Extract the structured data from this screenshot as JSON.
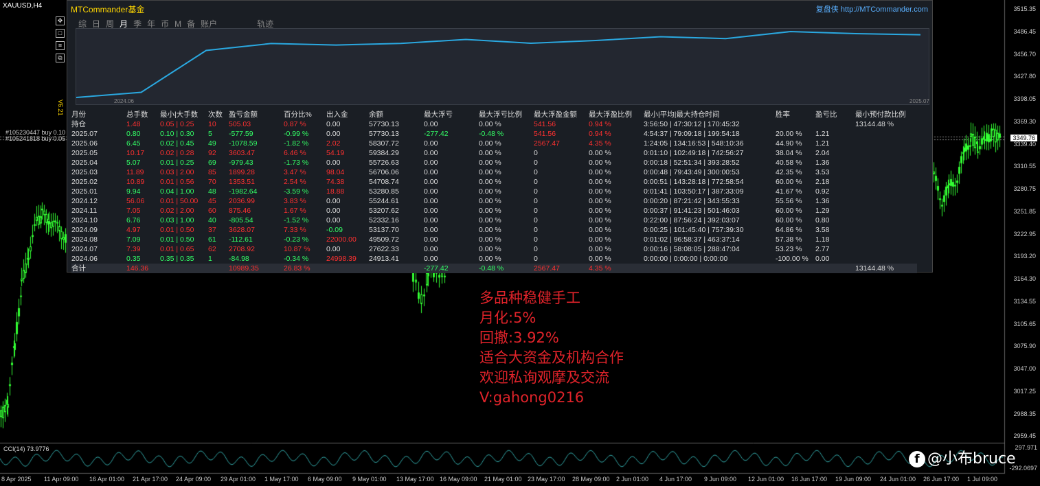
{
  "symbol": "XAUUSD,H4",
  "version": "V6.21",
  "orders": [
    "#105230447 buy 0.10",
    "#105241818 buy 0.05"
  ],
  "price_axis": [
    "3515.35",
    "3486.45",
    "3456.70",
    "3427.80",
    "3398.05",
    "3369.30",
    "3339.40",
    "3310.55",
    "3280.75",
    "3251.85",
    "3222.95",
    "3193.20",
    "3164.30",
    "3134.55",
    "3105.65",
    "3075.90",
    "3047.00",
    "3017.25",
    "2988.35",
    "2959.45"
  ],
  "current_price": "3349.76",
  "cci": {
    "label": "CCI(14) 73.9776",
    "top": "297.971",
    "bottom": "-292.0697"
  },
  "date_axis": [
    "8 Apr 2025",
    "11 Apr 09:00",
    "16 Apr 01:00",
    "21 Apr 17:00",
    "24 Apr 09:00",
    "29 Apr 01:00",
    "1 May 17:00",
    "6 May 09:00",
    "9 May 01:00",
    "13 May 17:00",
    "16 May 09:00",
    "21 May 01:00",
    "23 May 17:00",
    "28 May 09:00",
    "2 Jun 01:00",
    "4 Jun 17:00",
    "9 Jun 09:00",
    "12 Jun 01:00",
    "16 Jun 17:00",
    "19 Jun 09:00",
    "24 Jun 01:00",
    "26 Jun 17:00",
    "1 Jul 09:00"
  ],
  "panel": {
    "title": "MTCommander基金",
    "link": "复盘侠 http://MTCommander.com",
    "tabs": [
      "综",
      "日",
      "周",
      "月",
      "季",
      "年",
      "币",
      "M",
      "备",
      "账户",
      "轨迹"
    ],
    "active_tab": "月",
    "mini_chart": {
      "start_label": "2024.06",
      "end_label": "2025.07",
      "values": [
        24913.41,
        27622.33,
        49509.72,
        53137.7,
        52332.16,
        53207.62,
        55244.61,
        53280.85,
        54708.74,
        56706.06,
        55726.63,
        59384.29,
        58307.72,
        57730.13
      ]
    },
    "headers": [
      "月份",
      "总手数",
      "最小|大手数",
      "次数",
      "盈亏金额",
      "百分比%",
      "出入金",
      "余额",
      "最大浮亏",
      "最大浮亏比例",
      "最大浮盈金额",
      "最大浮盈比例",
      "最小|平均|最大持仓时间",
      "胜率",
      "盈亏比",
      "最小预付款比例"
    ],
    "rows": [
      [
        "持仓",
        "1.48",
        "0.05 | 0.25",
        "10",
        "505.03",
        "0.87 %",
        "0.00",
        "57730.13",
        "0.00",
        "0.00 %",
        "541.56",
        "0.94 %",
        "3:56:50 | 47:30:12 | 170:45:32",
        "",
        "",
        "13144.48 %"
      ],
      [
        "2025.07",
        "0.80",
        "0.10 | 0.30",
        "5",
        "-577.59",
        "-0.99 %",
        "0.00",
        "57730.13",
        "-277.42",
        "-0.48 %",
        "541.56",
        "0.94 %",
        "4:54:37 | 79:09:18 | 199:54:18",
        "20.00 %",
        "1.21",
        ""
      ],
      [
        "2025.06",
        "6.45",
        "0.02 | 0.45",
        "49",
        "-1078.59",
        "-1.82 %",
        "2.02",
        "58307.72",
        "0.00",
        "0.00 %",
        "2567.47",
        "4.35 %",
        "1:24:05 | 134:16:53 | 548:10:36",
        "44.90 %",
        "1.21",
        ""
      ],
      [
        "2025.05",
        "10.17",
        "0.02 | 0.28",
        "92",
        "3603.47",
        "6.46 %",
        "54.19",
        "59384.29",
        "0.00",
        "0.00 %",
        "0",
        "0.00 %",
        "0:01:10 | 102:49:18 | 742:56:27",
        "38.04 %",
        "2.04",
        ""
      ],
      [
        "2025.04",
        "5.07",
        "0.01 | 0.25",
        "69",
        "-979.43",
        "-1.73 %",
        "0.00",
        "55726.63",
        "0.00",
        "0.00 %",
        "0",
        "0.00 %",
        "0:00:18 | 52:51:34 | 393:28:52",
        "40.58 %",
        "1.36",
        ""
      ],
      [
        "2025.03",
        "11.89",
        "0.03 | 2.00",
        "85",
        "1899.28",
        "3.47 %",
        "98.04",
        "56706.06",
        "0.00",
        "0.00 %",
        "0",
        "0.00 %",
        "0:00:48 | 79:43:49 | 300:00:53",
        "42.35 %",
        "3.53",
        ""
      ],
      [
        "2025.02",
        "10.89",
        "0.01 | 0.56",
        "70",
        "1353.51",
        "2.54 %",
        "74.38",
        "54708.74",
        "0.00",
        "0.00 %",
        "0",
        "0.00 %",
        "0:00:51 | 143:28:18 | 772:58:54",
        "60.00 %",
        "2.18",
        ""
      ],
      [
        "2025.01",
        "9.94",
        "0.04 | 1.00",
        "48",
        "-1982.64",
        "-3.59 %",
        "18.88",
        "53280.85",
        "0.00",
        "0.00 %",
        "0",
        "0.00 %",
        "0:01:41 | 103:50:17 | 387:33:09",
        "41.67 %",
        "0.92",
        ""
      ],
      [
        "2024.12",
        "56.06",
        "0.01 | 50.00",
        "45",
        "2036.99",
        "3.83 %",
        "0.00",
        "55244.61",
        "0.00",
        "0.00 %",
        "0",
        "0.00 %",
        "0:00:20 | 87:21:42 | 343:55:33",
        "55.56 %",
        "1.36",
        ""
      ],
      [
        "2024.11",
        "7.05",
        "0.02 | 2.00",
        "60",
        "875.46",
        "1.67 %",
        "0.00",
        "53207.62",
        "0.00",
        "0.00 %",
        "0",
        "0.00 %",
        "0:00:37 | 91:41:23 | 501:46:03",
        "60.00 %",
        "1.29",
        ""
      ],
      [
        "2024.10",
        "6.76",
        "0.03 | 1.00",
        "40",
        "-805.54",
        "-1.52 %",
        "0.00",
        "52332.16",
        "0.00",
        "0.00 %",
        "0",
        "0.00 %",
        "0:22:00 | 87:56:24 | 392:03:07",
        "60.00 %",
        "0.80",
        ""
      ],
      [
        "2024.09",
        "4.97",
        "0.01 | 0.50",
        "37",
        "3628.07",
        "7.33 %",
        "-0.09",
        "53137.70",
        "0.00",
        "0.00 %",
        "0",
        "0.00 %",
        "0:00:25 | 101:45:40 | 757:39:30",
        "64.86 %",
        "3.58",
        ""
      ],
      [
        "2024.08",
        "7.09",
        "0.01 | 0.50",
        "61",
        "-112.61",
        "-0.23 %",
        "22000.00",
        "49509.72",
        "0.00",
        "0.00 %",
        "0",
        "0.00 %",
        "0:01:02 | 96:58:37 | 463:37:14",
        "57.38 %",
        "1.18",
        ""
      ],
      [
        "2024.07",
        "7.39",
        "0.01 | 0.65",
        "62",
        "2708.92",
        "10.87 %",
        "0.00",
        "27622.33",
        "0.00",
        "0.00 %",
        "0",
        "0.00 %",
        "0:00:16 | 58:08:05 | 288:47:04",
        "53.23 %",
        "2.77",
        ""
      ],
      [
        "2024.06",
        "0.35",
        "0.35 | 0.35",
        "1",
        "-84.98",
        "-0.34 %",
        "24998.39",
        "24913.41",
        "0.00",
        "0.00 %",
        "0",
        "0.00 %",
        "0:00:00 | 0:00:00 | 0:00:00",
        "-100.00 %",
        "0.00",
        ""
      ]
    ],
    "row_colors": [
      [
        "w",
        "r",
        "r",
        "r",
        "r",
        "r",
        "w",
        "w",
        "w",
        "w",
        "r",
        "r",
        "w",
        "w",
        "w",
        "w"
      ],
      [
        "w",
        "g",
        "g",
        "g",
        "g",
        "g",
        "w",
        "w",
        "g",
        "g",
        "r",
        "r",
        "w",
        "w",
        "w",
        "w"
      ],
      [
        "w",
        "g",
        "g",
        "g",
        "g",
        "g",
        "r",
        "w",
        "w",
        "w",
        "r",
        "r",
        "w",
        "w",
        "w",
        "w"
      ],
      [
        "w",
        "r",
        "r",
        "r",
        "r",
        "r",
        "r",
        "w",
        "w",
        "w",
        "w",
        "w",
        "w",
        "w",
        "w",
        "w"
      ],
      [
        "w",
        "g",
        "g",
        "g",
        "g",
        "g",
        "w",
        "w",
        "w",
        "w",
        "w",
        "w",
        "w",
        "w",
        "w",
        "w"
      ],
      [
        "w",
        "r",
        "r",
        "r",
        "r",
        "r",
        "r",
        "w",
        "w",
        "w",
        "w",
        "w",
        "w",
        "w",
        "w",
        "w"
      ],
      [
        "w",
        "r",
        "r",
        "r",
        "r",
        "r",
        "r",
        "w",
        "w",
        "w",
        "w",
        "w",
        "w",
        "w",
        "w",
        "w"
      ],
      [
        "w",
        "g",
        "g",
        "g",
        "g",
        "g",
        "r",
        "w",
        "w",
        "w",
        "w",
        "w",
        "w",
        "w",
        "w",
        "w"
      ],
      [
        "w",
        "r",
        "r",
        "r",
        "r",
        "r",
        "w",
        "w",
        "w",
        "w",
        "w",
        "w",
        "w",
        "w",
        "w",
        "w"
      ],
      [
        "w",
        "r",
        "r",
        "r",
        "r",
        "r",
        "w",
        "w",
        "w",
        "w",
        "w",
        "w",
        "w",
        "w",
        "w",
        "w"
      ],
      [
        "w",
        "g",
        "g",
        "g",
        "g",
        "g",
        "w",
        "w",
        "w",
        "w",
        "w",
        "w",
        "w",
        "w",
        "w",
        "w"
      ],
      [
        "w",
        "r",
        "r",
        "r",
        "r",
        "r",
        "g",
        "w",
        "w",
        "w",
        "w",
        "w",
        "w",
        "w",
        "w",
        "w"
      ],
      [
        "w",
        "g",
        "g",
        "g",
        "g",
        "g",
        "r",
        "w",
        "w",
        "w",
        "w",
        "w",
        "w",
        "w",
        "w",
        "w"
      ],
      [
        "w",
        "r",
        "r",
        "r",
        "r",
        "r",
        "w",
        "w",
        "w",
        "w",
        "w",
        "w",
        "w",
        "w",
        "w",
        "w"
      ],
      [
        "w",
        "g",
        "g",
        "g",
        "g",
        "g",
        "r",
        "w",
        "w",
        "w",
        "w",
        "w",
        "w",
        "w",
        "w",
        "w"
      ]
    ],
    "total": [
      "合计",
      "146.36",
      "",
      "",
      "10989.35",
      "26.83 %",
      "",
      "",
      "-277.42",
      "-0.48 %",
      "2567.47",
      "4.35 %",
      "",
      "",
      "",
      "13144.48 %"
    ],
    "total_colors": [
      "w",
      "r",
      "w",
      "w",
      "r",
      "r",
      "w",
      "w",
      "g",
      "g",
      "r",
      "r",
      "w",
      "w",
      "w",
      "w"
    ]
  },
  "ad_text": [
    "多品种稳健手工",
    "月化:5%",
    "回撤:3.92%",
    "适合大资金及机构合作",
    "欢迎私询观摩及交流",
    "V:gahong0216"
  ],
  "watermark": "@小布bruce",
  "colors": {
    "bull": "#33ff33",
    "line": "#2aa8e0",
    "ad": "#e0232a",
    "title": "#ffd700"
  }
}
